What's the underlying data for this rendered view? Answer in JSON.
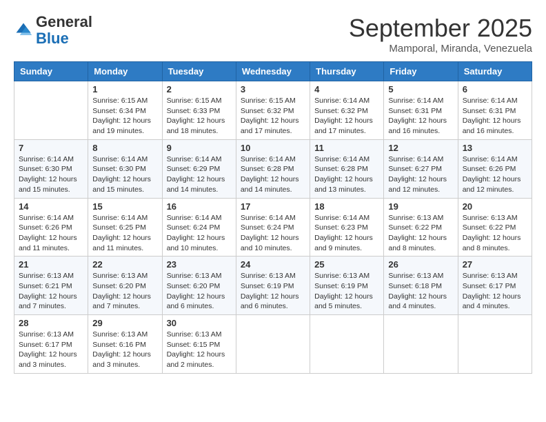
{
  "logo": {
    "general": "General",
    "blue": "Blue"
  },
  "title": "September 2025",
  "subtitle": "Mamporal, Miranda, Venezuela",
  "days_of_week": [
    "Sunday",
    "Monday",
    "Tuesday",
    "Wednesday",
    "Thursday",
    "Friday",
    "Saturday"
  ],
  "weeks": [
    [
      {
        "day": "",
        "info": ""
      },
      {
        "day": "1",
        "info": "Sunrise: 6:15 AM\nSunset: 6:34 PM\nDaylight: 12 hours\nand 19 minutes."
      },
      {
        "day": "2",
        "info": "Sunrise: 6:15 AM\nSunset: 6:33 PM\nDaylight: 12 hours\nand 18 minutes."
      },
      {
        "day": "3",
        "info": "Sunrise: 6:15 AM\nSunset: 6:32 PM\nDaylight: 12 hours\nand 17 minutes."
      },
      {
        "day": "4",
        "info": "Sunrise: 6:14 AM\nSunset: 6:32 PM\nDaylight: 12 hours\nand 17 minutes."
      },
      {
        "day": "5",
        "info": "Sunrise: 6:14 AM\nSunset: 6:31 PM\nDaylight: 12 hours\nand 16 minutes."
      },
      {
        "day": "6",
        "info": "Sunrise: 6:14 AM\nSunset: 6:31 PM\nDaylight: 12 hours\nand 16 minutes."
      }
    ],
    [
      {
        "day": "7",
        "info": "Sunrise: 6:14 AM\nSunset: 6:30 PM\nDaylight: 12 hours\nand 15 minutes."
      },
      {
        "day": "8",
        "info": "Sunrise: 6:14 AM\nSunset: 6:30 PM\nDaylight: 12 hours\nand 15 minutes."
      },
      {
        "day": "9",
        "info": "Sunrise: 6:14 AM\nSunset: 6:29 PM\nDaylight: 12 hours\nand 14 minutes."
      },
      {
        "day": "10",
        "info": "Sunrise: 6:14 AM\nSunset: 6:28 PM\nDaylight: 12 hours\nand 14 minutes."
      },
      {
        "day": "11",
        "info": "Sunrise: 6:14 AM\nSunset: 6:28 PM\nDaylight: 12 hours\nand 13 minutes."
      },
      {
        "day": "12",
        "info": "Sunrise: 6:14 AM\nSunset: 6:27 PM\nDaylight: 12 hours\nand 12 minutes."
      },
      {
        "day": "13",
        "info": "Sunrise: 6:14 AM\nSunset: 6:26 PM\nDaylight: 12 hours\nand 12 minutes."
      }
    ],
    [
      {
        "day": "14",
        "info": "Sunrise: 6:14 AM\nSunset: 6:26 PM\nDaylight: 12 hours\nand 11 minutes."
      },
      {
        "day": "15",
        "info": "Sunrise: 6:14 AM\nSunset: 6:25 PM\nDaylight: 12 hours\nand 11 minutes."
      },
      {
        "day": "16",
        "info": "Sunrise: 6:14 AM\nSunset: 6:24 PM\nDaylight: 12 hours\nand 10 minutes."
      },
      {
        "day": "17",
        "info": "Sunrise: 6:14 AM\nSunset: 6:24 PM\nDaylight: 12 hours\nand 10 minutes."
      },
      {
        "day": "18",
        "info": "Sunrise: 6:14 AM\nSunset: 6:23 PM\nDaylight: 12 hours\nand 9 minutes."
      },
      {
        "day": "19",
        "info": "Sunrise: 6:13 AM\nSunset: 6:22 PM\nDaylight: 12 hours\nand 8 minutes."
      },
      {
        "day": "20",
        "info": "Sunrise: 6:13 AM\nSunset: 6:22 PM\nDaylight: 12 hours\nand 8 minutes."
      }
    ],
    [
      {
        "day": "21",
        "info": "Sunrise: 6:13 AM\nSunset: 6:21 PM\nDaylight: 12 hours\nand 7 minutes."
      },
      {
        "day": "22",
        "info": "Sunrise: 6:13 AM\nSunset: 6:20 PM\nDaylight: 12 hours\nand 7 minutes."
      },
      {
        "day": "23",
        "info": "Sunrise: 6:13 AM\nSunset: 6:20 PM\nDaylight: 12 hours\nand 6 minutes."
      },
      {
        "day": "24",
        "info": "Sunrise: 6:13 AM\nSunset: 6:19 PM\nDaylight: 12 hours\nand 6 minutes."
      },
      {
        "day": "25",
        "info": "Sunrise: 6:13 AM\nSunset: 6:19 PM\nDaylight: 12 hours\nand 5 minutes."
      },
      {
        "day": "26",
        "info": "Sunrise: 6:13 AM\nSunset: 6:18 PM\nDaylight: 12 hours\nand 4 minutes."
      },
      {
        "day": "27",
        "info": "Sunrise: 6:13 AM\nSunset: 6:17 PM\nDaylight: 12 hours\nand 4 minutes."
      }
    ],
    [
      {
        "day": "28",
        "info": "Sunrise: 6:13 AM\nSunset: 6:17 PM\nDaylight: 12 hours\nand 3 minutes."
      },
      {
        "day": "29",
        "info": "Sunrise: 6:13 AM\nSunset: 6:16 PM\nDaylight: 12 hours\nand 3 minutes."
      },
      {
        "day": "30",
        "info": "Sunrise: 6:13 AM\nSunset: 6:15 PM\nDaylight: 12 hours\nand 2 minutes."
      },
      {
        "day": "",
        "info": ""
      },
      {
        "day": "",
        "info": ""
      },
      {
        "day": "",
        "info": ""
      },
      {
        "day": "",
        "info": ""
      }
    ]
  ]
}
